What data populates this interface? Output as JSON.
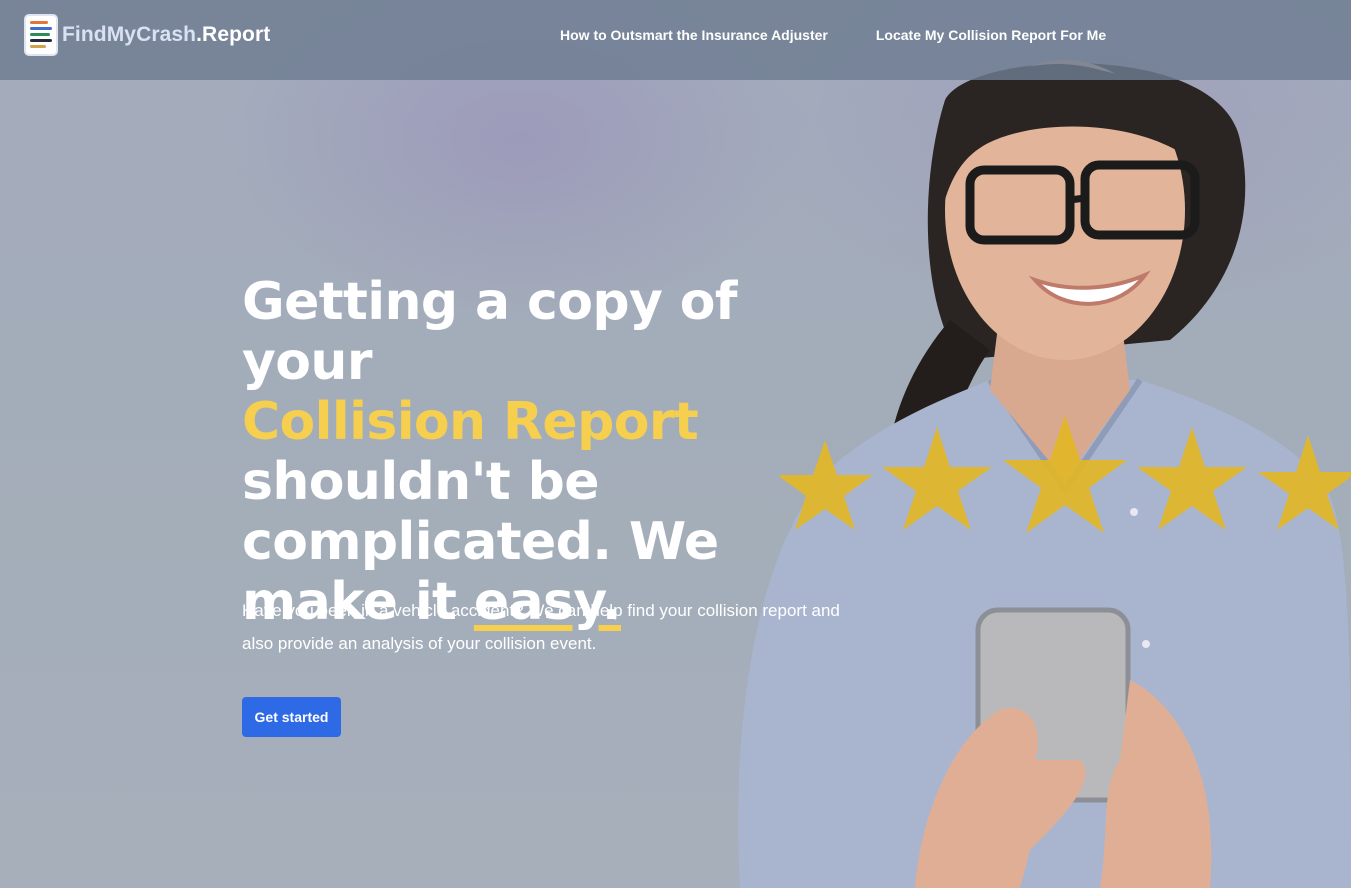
{
  "header": {
    "logo_brand": "FindMyCrash",
    "logo_suffix": ".Report",
    "nav": [
      {
        "label": "How to Outsmart the Insurance Adjuster"
      },
      {
        "label": "Locate My Collision Report For Me"
      }
    ]
  },
  "hero": {
    "headline_part1": "Getting a copy of your",
    "headline_accent": "Collision Report",
    "headline_part2": "shouldn't be complicated. We make it ",
    "headline_underlined": "easy.",
    "subtext": "Have you been in a vehicle accident? We can help find your collision report and also provide an analysis of your collision event.",
    "cta_label": "Get started",
    "star_rating": 5
  },
  "colors": {
    "accent_yellow": "#f5cf4d",
    "cta_blue": "#2f6ae6",
    "nav_bg": "#6e7c91"
  },
  "icons": [
    "document-list-icon",
    "star-icon"
  ]
}
